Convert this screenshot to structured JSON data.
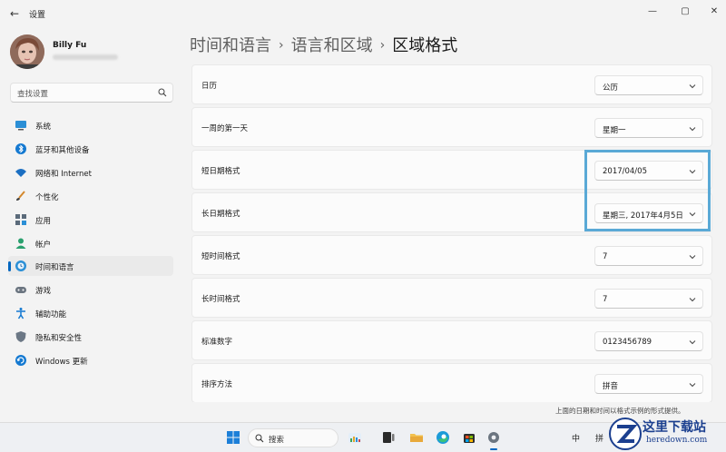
{
  "window": {
    "back_glyph": "←",
    "title": "设置",
    "minimize_glyph": "—",
    "maximize_glyph": "▢",
    "close_glyph": "✕"
  },
  "profile": {
    "name": "Billy Fu"
  },
  "search": {
    "placeholder": "查找设置"
  },
  "sidebar": {
    "items": [
      {
        "label": "系统",
        "icon": "monitor-icon",
        "active": false
      },
      {
        "label": "蓝牙和其他设备",
        "icon": "bluetooth-icon",
        "active": false
      },
      {
        "label": "网络和 Internet",
        "icon": "wifi-icon",
        "active": false
      },
      {
        "label": "个性化",
        "icon": "brush-icon",
        "active": false
      },
      {
        "label": "应用",
        "icon": "apps-icon",
        "active": false
      },
      {
        "label": "帐户",
        "icon": "person-icon",
        "active": false
      },
      {
        "label": "时间和语言",
        "icon": "globe-clock-icon",
        "active": true
      },
      {
        "label": "游戏",
        "icon": "gamepad-icon",
        "active": false
      },
      {
        "label": "辅助功能",
        "icon": "accessibility-icon",
        "active": false
      },
      {
        "label": "隐私和安全性",
        "icon": "shield-icon",
        "active": false
      },
      {
        "label": "Windows 更新",
        "icon": "update-icon",
        "active": false
      }
    ]
  },
  "breadcrumb": {
    "part1": "时间和语言",
    "part2": "语言和区域",
    "current": "区域格式",
    "separator": "›"
  },
  "settings": {
    "rows": [
      {
        "label": "日历",
        "value": "公历"
      },
      {
        "label": "一周的第一天",
        "value": "星期一"
      },
      {
        "label": "短日期格式",
        "value": "2017/04/05"
      },
      {
        "label": "长日期格式",
        "value": "星期三, 2017年4月5日"
      },
      {
        "label": "短时间格式",
        "value": "7"
      },
      {
        "label": "长时间格式",
        "value": "7"
      },
      {
        "label": "标准数字",
        "value": "0123456789"
      },
      {
        "label": "排序方法",
        "value": "拼音"
      }
    ]
  },
  "footnote": "上面的日期和时间以格式示例的形式提供。",
  "taskbar": {
    "search_label": "搜索",
    "tray_lang": "中",
    "tray_ime": "拼"
  },
  "watermark": {
    "text": "这里下载站",
    "domain": "heredown.com"
  },
  "colors": {
    "accent": "#0067c0",
    "highlight_box": "#5aa9d6",
    "background": "#f3f3f3",
    "card": "#fbfbfb"
  }
}
